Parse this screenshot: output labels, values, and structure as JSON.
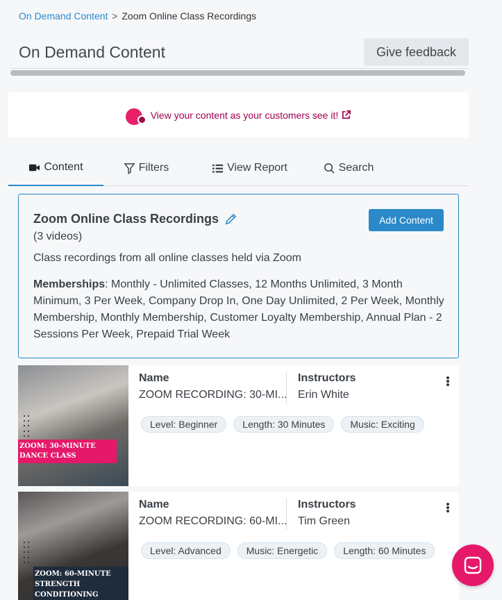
{
  "breadcrumb": {
    "link": "On Demand Content",
    "separator": ">",
    "current": "Zoom Online Class Recordings"
  },
  "header": {
    "title": "On Demand Content",
    "feedback_label": "Give feedback"
  },
  "banner": {
    "text": "View your content as your customers see it!",
    "icon": "external-link-icon"
  },
  "tabs": [
    {
      "label": "Content",
      "icon": "video-camera-icon",
      "active": true
    },
    {
      "label": "Filters",
      "icon": "funnel-icon"
    },
    {
      "label": "View Report",
      "icon": "list-icon"
    },
    {
      "label": "Search",
      "icon": "magnifier-icon"
    }
  ],
  "collection": {
    "title": "Zoom Online Class Recordings",
    "count": "(3 videos)",
    "add_label": "Add Content",
    "description": "Class recordings from all online classes held via Zoom",
    "memberships_label": "Memberships",
    "memberships": ": Monthly - Unlimited Classes, 12 Months Unlimited, 3 Month Minimum, 3 Per Week, Company Drop In, One Day Unlimited, 2 Per Week, Monthly Membership, Monthly Membership, Customer Loyalty Membership, Annual Plan - 2 Sessions Per Week, Prepaid Trial Week"
  },
  "videos": [
    {
      "name_label": "Name",
      "name": "ZOOM RECORDING: 30-MI...",
      "instructors_label": "Instructors",
      "instructor": "Erin White",
      "thumb_text": "ZOOM: 30-MINUTE DANCE CLASS",
      "tags": [
        "Level: Beginner",
        "Length: 30 Minutes",
        "Music: Exciting"
      ]
    },
    {
      "name_label": "Name",
      "name": "ZOOM RECORDING: 60-MI...",
      "instructors_label": "Instructors",
      "instructor": "Tim Green",
      "thumb_text": "ZOOM: 60-MINUTE STRENGTH CONDITIONING",
      "tags": [
        "Level: Advanced",
        "Music: Energetic",
        "Length: 60 Minutes"
      ]
    }
  ],
  "colors": {
    "accent": "#2a89c8",
    "brand_pink": "#e5186a",
    "link_magenta": "#a1004f"
  }
}
